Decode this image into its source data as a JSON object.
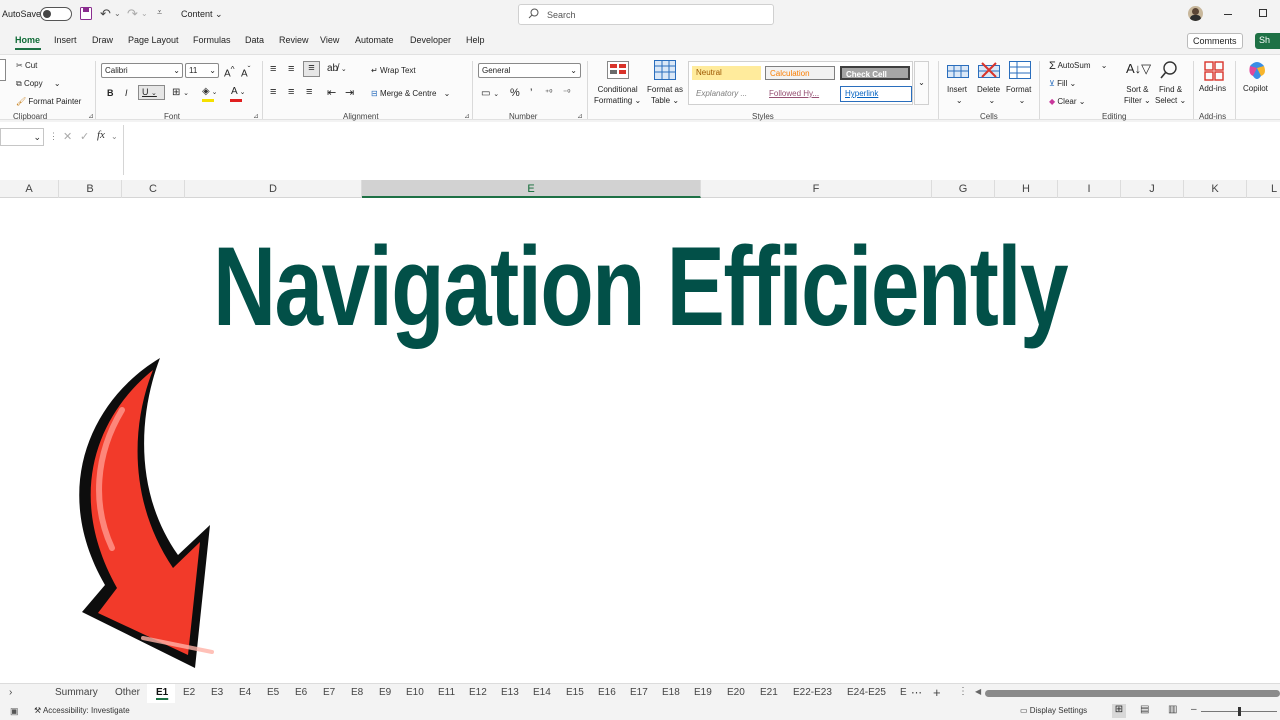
{
  "titlebar": {
    "autosave_label": "AutoSave",
    "autosave_state": "Off",
    "document_name": "Content",
    "search_placeholder": "Search"
  },
  "tabs": [
    "Home",
    "Insert",
    "Draw",
    "Page Layout",
    "Formulas",
    "Data",
    "Review",
    "View",
    "Automate",
    "Developer",
    "Help"
  ],
  "active_tab": "Home",
  "right_buttons": {
    "comments": "Comments",
    "share": "Sh"
  },
  "clipboard": {
    "cut": "Cut",
    "copy": "Copy",
    "format_painter": "Format Painter",
    "label": "Clipboard"
  },
  "font": {
    "family": "Calibri",
    "size": "11",
    "label": "Font"
  },
  "alignment": {
    "wrap_text": "Wrap Text",
    "merge": "Merge & Centre",
    "label": "Alignment"
  },
  "number": {
    "format": "General",
    "label": "Number"
  },
  "styles": {
    "conditional_1": "Conditional",
    "conditional_2": "Formatting",
    "format_table_1": "Format as",
    "format_table_2": "Table",
    "neutral": "Neutral",
    "calculation": "Calculation",
    "check_cell": "Check Cell",
    "explanatory": "Explanatory ...",
    "followed": "Followed Hy...",
    "hyperlink": "Hyperlink",
    "label": "Styles"
  },
  "cells": {
    "insert": "Insert",
    "delete": "Delete",
    "format": "Format",
    "label": "Cells"
  },
  "editing": {
    "autosum": "AutoSum",
    "fill": "Fill",
    "clear": "Clear",
    "sort_1": "Sort &",
    "sort_2": "Filter",
    "find_1": "Find &",
    "find_2": "Select",
    "label": "Editing"
  },
  "addins": {
    "addins": "Add-ins",
    "label": "Add-ins",
    "copilot": "Copilot"
  },
  "formula_bar": {
    "fx": "fx"
  },
  "columns": [
    "A",
    "B",
    "C",
    "D",
    "E",
    "F",
    "G",
    "H",
    "I",
    "J",
    "K",
    "L"
  ],
  "selected_column": "E",
  "headline": "Navigation Efficiently",
  "sheets": [
    "Summary",
    "Other",
    "E1",
    "E2",
    "E3",
    "E4",
    "E5",
    "E6",
    "E7",
    "E8",
    "E9",
    "E10",
    "E11",
    "E12",
    "E13",
    "E14",
    "E15",
    "E16",
    "E17",
    "E18",
    "E19",
    "E20",
    "E21",
    "E22-E23",
    "E24-E25",
    "E"
  ],
  "active_sheet": "E1",
  "statusbar": {
    "accessibility": "Accessibility: Investigate",
    "display_settings": "Display Settings"
  },
  "colors": {
    "accent": "#1e7145",
    "headline": "#025048",
    "arrow": "#f23a2a"
  }
}
